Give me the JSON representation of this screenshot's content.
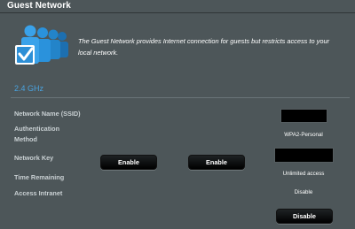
{
  "title": "Guest Network",
  "description": "The Guest Network provides Internet connection for guests but restricts access to your local network.",
  "band": {
    "label": "2.4 GHz"
  },
  "labels": {
    "ssid": "Network Name (SSID)",
    "auth_line1": "Authentication",
    "auth_line2": "Method",
    "key": "Network Key",
    "time": "Time Remaining",
    "intranet": "Access Intranet"
  },
  "values": {
    "auth": "WPA2-Personal",
    "time": "Unlimited access",
    "intranet": "Disable"
  },
  "buttons": {
    "enable_1": "Enable",
    "enable_2": "Enable",
    "disable": "Disable"
  },
  "colors": {
    "background": "#4d5659",
    "band_title": "#4aa3df",
    "icon_blue": "#2d8fd6"
  }
}
